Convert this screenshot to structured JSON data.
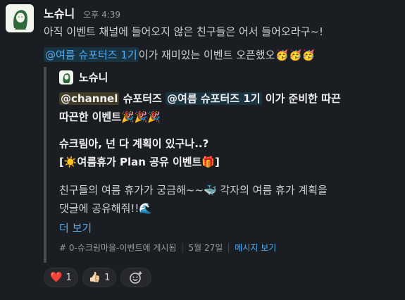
{
  "message": {
    "sender": "노슈니",
    "time": "오후 4:39",
    "line1": "아직 이벤트 채널에 들어오지 않은 친구들은 어서 들어오라구~!",
    "line2": {
      "mention": "@여름 슈포터즈 1기",
      "text": " 이가 재미있는 이벤트 오픈했오",
      "emojis": "🥳🥳🥳"
    }
  },
  "quote": {
    "sender": "노슈니",
    "l1": {
      "channel": "@channel",
      "a": " 슈포터즈 ",
      "mention": "@여름 슈포터즈 1기",
      "b": " 이가 준비한 따끈"
    },
    "l2": {
      "text": "따끈한 이벤트",
      "emojis": "🎉🎉🎉"
    },
    "l3": "슈크림아, 넌 다 계획이 있구나..?",
    "l4": {
      "a": "[",
      "sun": "☀️",
      "text": "여름휴가 Plan 공유 이벤트",
      "gift": "🎁",
      "b": "]"
    },
    "l5": {
      "text": "친구들의 여름 휴가가 궁금해~~",
      "whale": "🐳",
      "rest": " 각자의 여름 휴가 계획을"
    },
    "l6": {
      "text": "댓글에 공유해줘!!",
      "wave": "🌊"
    },
    "more": "더 보기",
    "footer": {
      "channel": "# 0-슈크림마을-이벤트에 게시됨",
      "date": "5월 27일",
      "link": "메시지 보기"
    }
  },
  "reactions": [
    {
      "emoji": "❤️",
      "count": "1"
    },
    {
      "emoji": "👍🏻",
      "count": "1"
    }
  ],
  "add_reaction_icon": "add-emoji-icon"
}
